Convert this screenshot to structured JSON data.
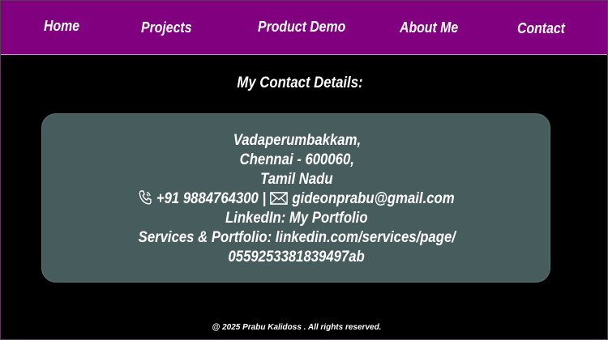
{
  "nav": {
    "items": [
      {
        "label": "Home"
      },
      {
        "label": "Projects"
      },
      {
        "label": "Product Demo"
      },
      {
        "label": "About Me"
      },
      {
        "label": "Contact"
      }
    ]
  },
  "colors": {
    "navbar_bg": "#800080",
    "page_bg": "#000000",
    "card_bg": "#475c5c",
    "text": "#ffffff"
  },
  "main": {
    "title": "My Contact Details:"
  },
  "contact": {
    "address_line1": "Vadaperumbakkam,",
    "address_line2": "Chennai - 600060,",
    "address_line3": "Tamil Nadu",
    "phone_icon": "phone-icon",
    "phone": "+91 9884764300",
    "separator": "|",
    "email_icon": "envelope-icon",
    "email": "gideonprabu@gmail.com",
    "linkedin_prefix": "LinkedIn:",
    "linkedin_link": "My Portfolio",
    "services_prefix": "Services & Portfolio:",
    "services_link_part1": "linkedin.com/services/page/",
    "services_link_part2": "0559253381839497ab"
  },
  "footer": {
    "text": "@ 2025 Prabu Kalidoss . All rights reserved."
  }
}
